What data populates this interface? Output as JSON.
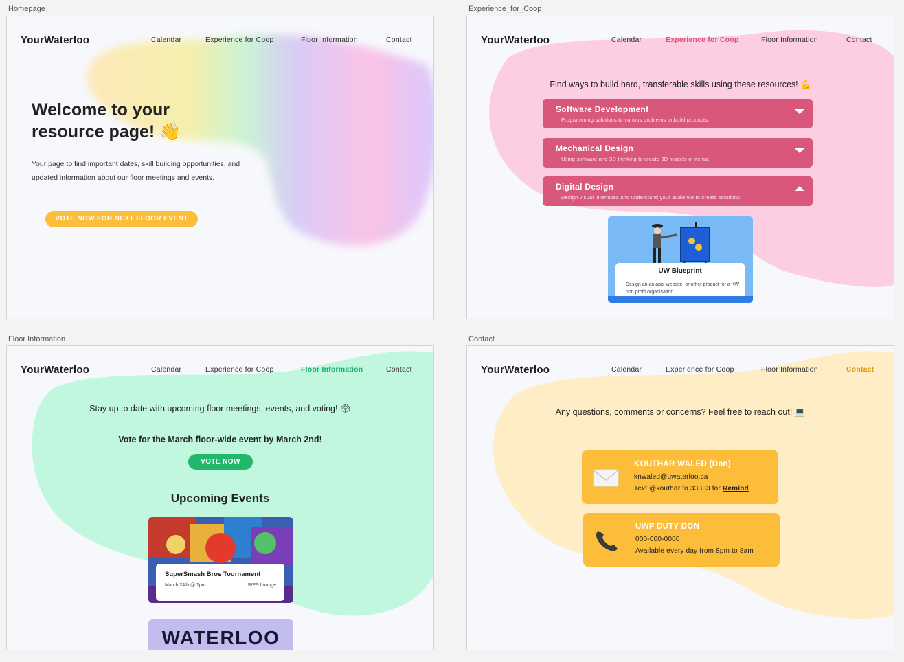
{
  "brand": "YourWaterloo",
  "nav": [
    "Calendar",
    "Experience for Coop",
    "Floor Information",
    "Contact"
  ],
  "frames": {
    "homepage": {
      "label": "Homepage",
      "hero_title_line1": "Welcome to your",
      "hero_title_line2": "resource page! 👋",
      "hero_desc": "Your page to find important dates, skill building opportunities, and updated information about our floor meetings and events.",
      "vote_button": "VOTE NOW FOR NEXT FLOOR EVENT"
    },
    "coop": {
      "label": "Experience_for_Coop",
      "intro": "Find ways to build hard, transferable skills using these resources! 💪",
      "accordions": [
        {
          "title": "Software Development",
          "subtitle": "Programming solutions to various problems to build products.",
          "state": "collapsed"
        },
        {
          "title": "Mechanical Design",
          "subtitle": "Using software and 3D thinking to create 3D models of items.",
          "state": "collapsed"
        },
        {
          "title": "Digital Design",
          "subtitle": "Design visual interfaces and understand your audience to create solutions.",
          "state": "expanded"
        }
      ],
      "card": {
        "title": "UW Blueprint",
        "desc": "Design an an app, website, or other product for a KW non profit organisation."
      }
    },
    "floor": {
      "label": "Floor Information",
      "intro": "Stay up to date with upcoming floor meetings, events, and voting! 🗳",
      "vote_text": "Vote for the March floor-wide event by March 2nd!",
      "vote_button": "VOTE NOW",
      "upcoming_title": "Upcoming Events",
      "event": {
        "title": "SuperSmash Bros Tournament",
        "date": "March 24th @ 7pm",
        "location": "WES Lounge"
      },
      "next_card_text": "WATERLOO"
    },
    "contact": {
      "label": "Contact",
      "intro": "Any questions, comments or concerns? Feel free to reach out! 💻",
      "cards": [
        {
          "name": "KOUTHAR WALED (Don)",
          "line1": "knwaled@uwaterloo.ca",
          "line2_prefix": "Text @kouthar to 33333 for ",
          "line2_link": "Remind",
          "icon": "envelope-icon"
        },
        {
          "name": "UWP DUTY DON",
          "line1": "000-000-0000",
          "line2_prefix": "Available every day from 8pm to 8am",
          "line2_link": "",
          "icon": "phone-icon"
        }
      ]
    }
  },
  "colors": {
    "pink": "#d9577a",
    "green": "#21b86c",
    "gold": "#fbbd3a",
    "blue": "#79b9f5"
  }
}
